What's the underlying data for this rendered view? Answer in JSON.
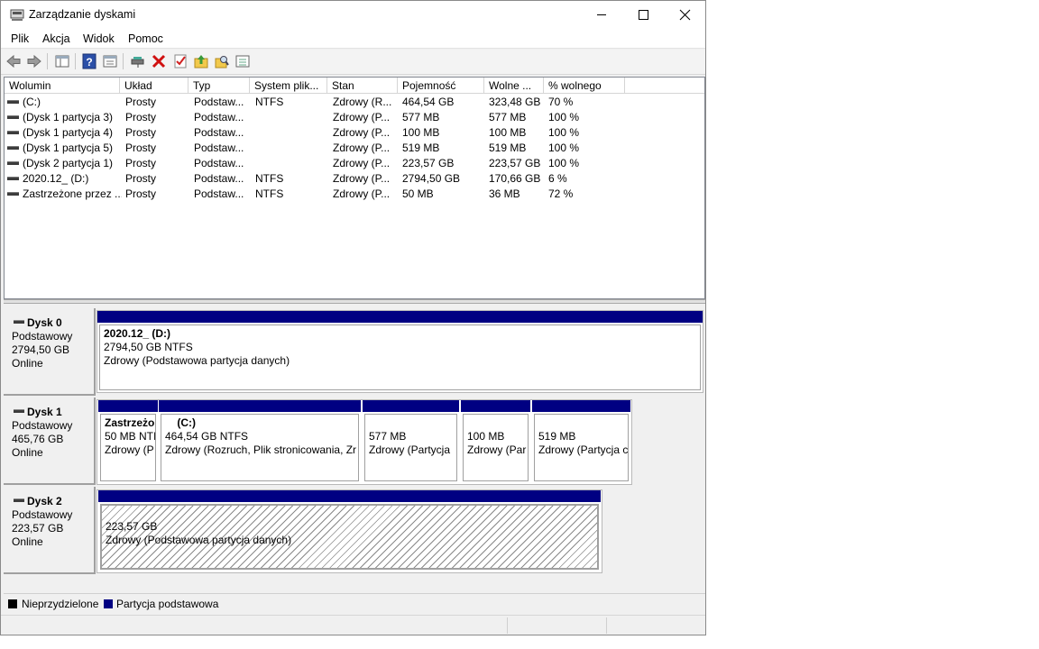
{
  "window": {
    "title": "Zarządzanie dyskami"
  },
  "menu": [
    "Plik",
    "Akcja",
    "Widok",
    "Pomoc"
  ],
  "toolbar_icons": [
    "back-arrow-icon",
    "forward-arrow-icon",
    "show-hide-tree-icon",
    "help-icon",
    "properties-icon",
    "connect-drive-icon",
    "delete-icon",
    "check-icon",
    "folder-up-icon",
    "search-folder-icon",
    "list-view-icon"
  ],
  "columns": [
    "Wolumin",
    "Układ",
    "Typ",
    "System plik...",
    "Stan",
    "Pojemność",
    "Wolne ...",
    "% wolnego"
  ],
  "volumes": [
    {
      "name": "(C:)",
      "layout": "Prosty",
      "type": "Podstaw...",
      "fs": "NTFS",
      "status": "Zdrowy (R...",
      "capacity": "464,54 GB",
      "free": "323,48 GB",
      "pct": "70 %"
    },
    {
      "name": "(Dysk 1 partycja 3)",
      "layout": "Prosty",
      "type": "Podstaw...",
      "fs": "",
      "status": "Zdrowy (P...",
      "capacity": "577 MB",
      "free": "577 MB",
      "pct": "100 %"
    },
    {
      "name": "(Dysk 1 partycja 4)",
      "layout": "Prosty",
      "type": "Podstaw...",
      "fs": "",
      "status": "Zdrowy (P...",
      "capacity": "100 MB",
      "free": "100 MB",
      "pct": "100 %"
    },
    {
      "name": "(Dysk 1 partycja 5)",
      "layout": "Prosty",
      "type": "Podstaw...",
      "fs": "",
      "status": "Zdrowy (P...",
      "capacity": "519 MB",
      "free": "519 MB",
      "pct": "100 %"
    },
    {
      "name": "(Dysk 2 partycja 1)",
      "layout": "Prosty",
      "type": "Podstaw...",
      "fs": "",
      "status": "Zdrowy (P...",
      "capacity": "223,57 GB",
      "free": "223,57 GB",
      "pct": "100 %"
    },
    {
      "name": "2020.12_ (D:)",
      "layout": "Prosty",
      "type": "Podstaw...",
      "fs": "NTFS",
      "status": "Zdrowy (P...",
      "capacity": "2794,50 GB",
      "free": "170,66 GB",
      "pct": "6 %"
    },
    {
      "name": "Zastrzeżone przez ...",
      "layout": "Prosty",
      "type": "Podstaw...",
      "fs": "NTFS",
      "status": "Zdrowy (P...",
      "capacity": "50 MB",
      "free": "36 MB",
      "pct": "72 %"
    }
  ],
  "disks": [
    {
      "name": "Dysk 0",
      "kind": "Podstawowy",
      "size": "2794,50 GB",
      "state": "Online",
      "partitions": [
        {
          "title": "2020.12_  (D:)",
          "line1": "2794,50 GB NTFS",
          "line2": "Zdrowy (Podstawowa partycja danych)"
        }
      ]
    },
    {
      "name": "Dysk 1",
      "kind": "Podstawowy",
      "size": "465,76 GB",
      "state": "Online",
      "partitions": [
        {
          "title": "Zastrzeżo",
          "line1": "50 MB NTI",
          "line2": "Zdrowy (P"
        },
        {
          "title": "    (C:)",
          "line1": "464,54 GB NTFS",
          "line2": "Zdrowy (Rozruch, Plik stronicowania, Zr"
        },
        {
          "title": "",
          "line1": "577 MB",
          "line2": "Zdrowy (Partycja"
        },
        {
          "title": "",
          "line1": "100 MB",
          "line2": "Zdrowy (Par"
        },
        {
          "title": "",
          "line1": "519 MB",
          "line2": "Zdrowy (Partycja c"
        }
      ]
    },
    {
      "name": "Dysk 2",
      "kind": "Podstawowy",
      "size": "223,57 GB",
      "state": "Online",
      "partitions": [
        {
          "title": "",
          "line1": "223,57 GB",
          "line2": "Zdrowy (Podstawowa partycja danych)"
        }
      ]
    }
  ],
  "legend": [
    {
      "label": "Nieprzydzielone",
      "color": "#000000"
    },
    {
      "label": "Partycja podstawowa",
      "color": "#000082"
    }
  ]
}
